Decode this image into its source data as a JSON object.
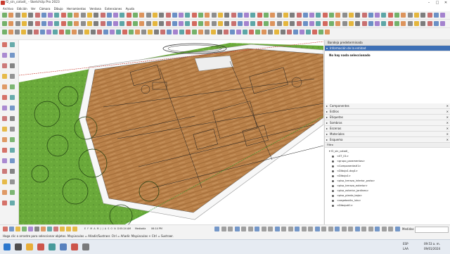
{
  "window": {
    "title": "f2_sin_cotadl_ - SketchUp Pro 2023"
  },
  "menu": [
    "Archivo",
    "Edición",
    "Ver",
    "Cámara",
    "Dibujo",
    "Herramientas",
    "Ventana",
    "Extensiones",
    "Ayuda"
  ],
  "tray": {
    "title": "Bandeja predeterminada",
    "entity_info": {
      "label": "Información de la entidad",
      "empty_text": "No hay nada seleccionado"
    },
    "sections": [
      "Componentes",
      "Estilos",
      "Etiquetas",
      "Sombras",
      "Escenas",
      "Materiales",
      "Esquema"
    ],
    "outliner": {
      "filter_label": "Filtro",
      "root": "f2_sin_cotadl_",
      "items": [
        "<ST_01>",
        "<grupo_paramentos>",
        "<Componente#1>",
        "<Dibujo1.dxg1>",
        "<Dibujo1>",
        "<piso_terrazo_interior_proto>",
        "<piso_terrazo_exterior>",
        "<piso_exterior_jardines>",
        "<piso_planta_baja>",
        "<vegetación_lulu>",
        "<Dibujo#1>"
      ]
    }
  },
  "status": {
    "measures_label": "Medidas",
    "time_left": "05:24 AM",
    "time_mid_label": "Mediodía",
    "time_right": "06:14 PM",
    "months": "E F M A M J J A S O N D"
  },
  "hint": "Haga clic o arrastre para seleccionar objetos. Mayúsculas = Añadir/Sustraer. Ctrl = Añadir. Mayúsculas + Ctrl = Sustraer.",
  "taskbar": {
    "lang": "ESP",
    "lang2": "LAA",
    "time": "09:53 a. m.",
    "date": "09/01/2024"
  },
  "colors": {
    "accent": "#3d6fb5",
    "grass": "#6fae3a",
    "floor": "#b88248",
    "wall": "#f4f4f4"
  }
}
